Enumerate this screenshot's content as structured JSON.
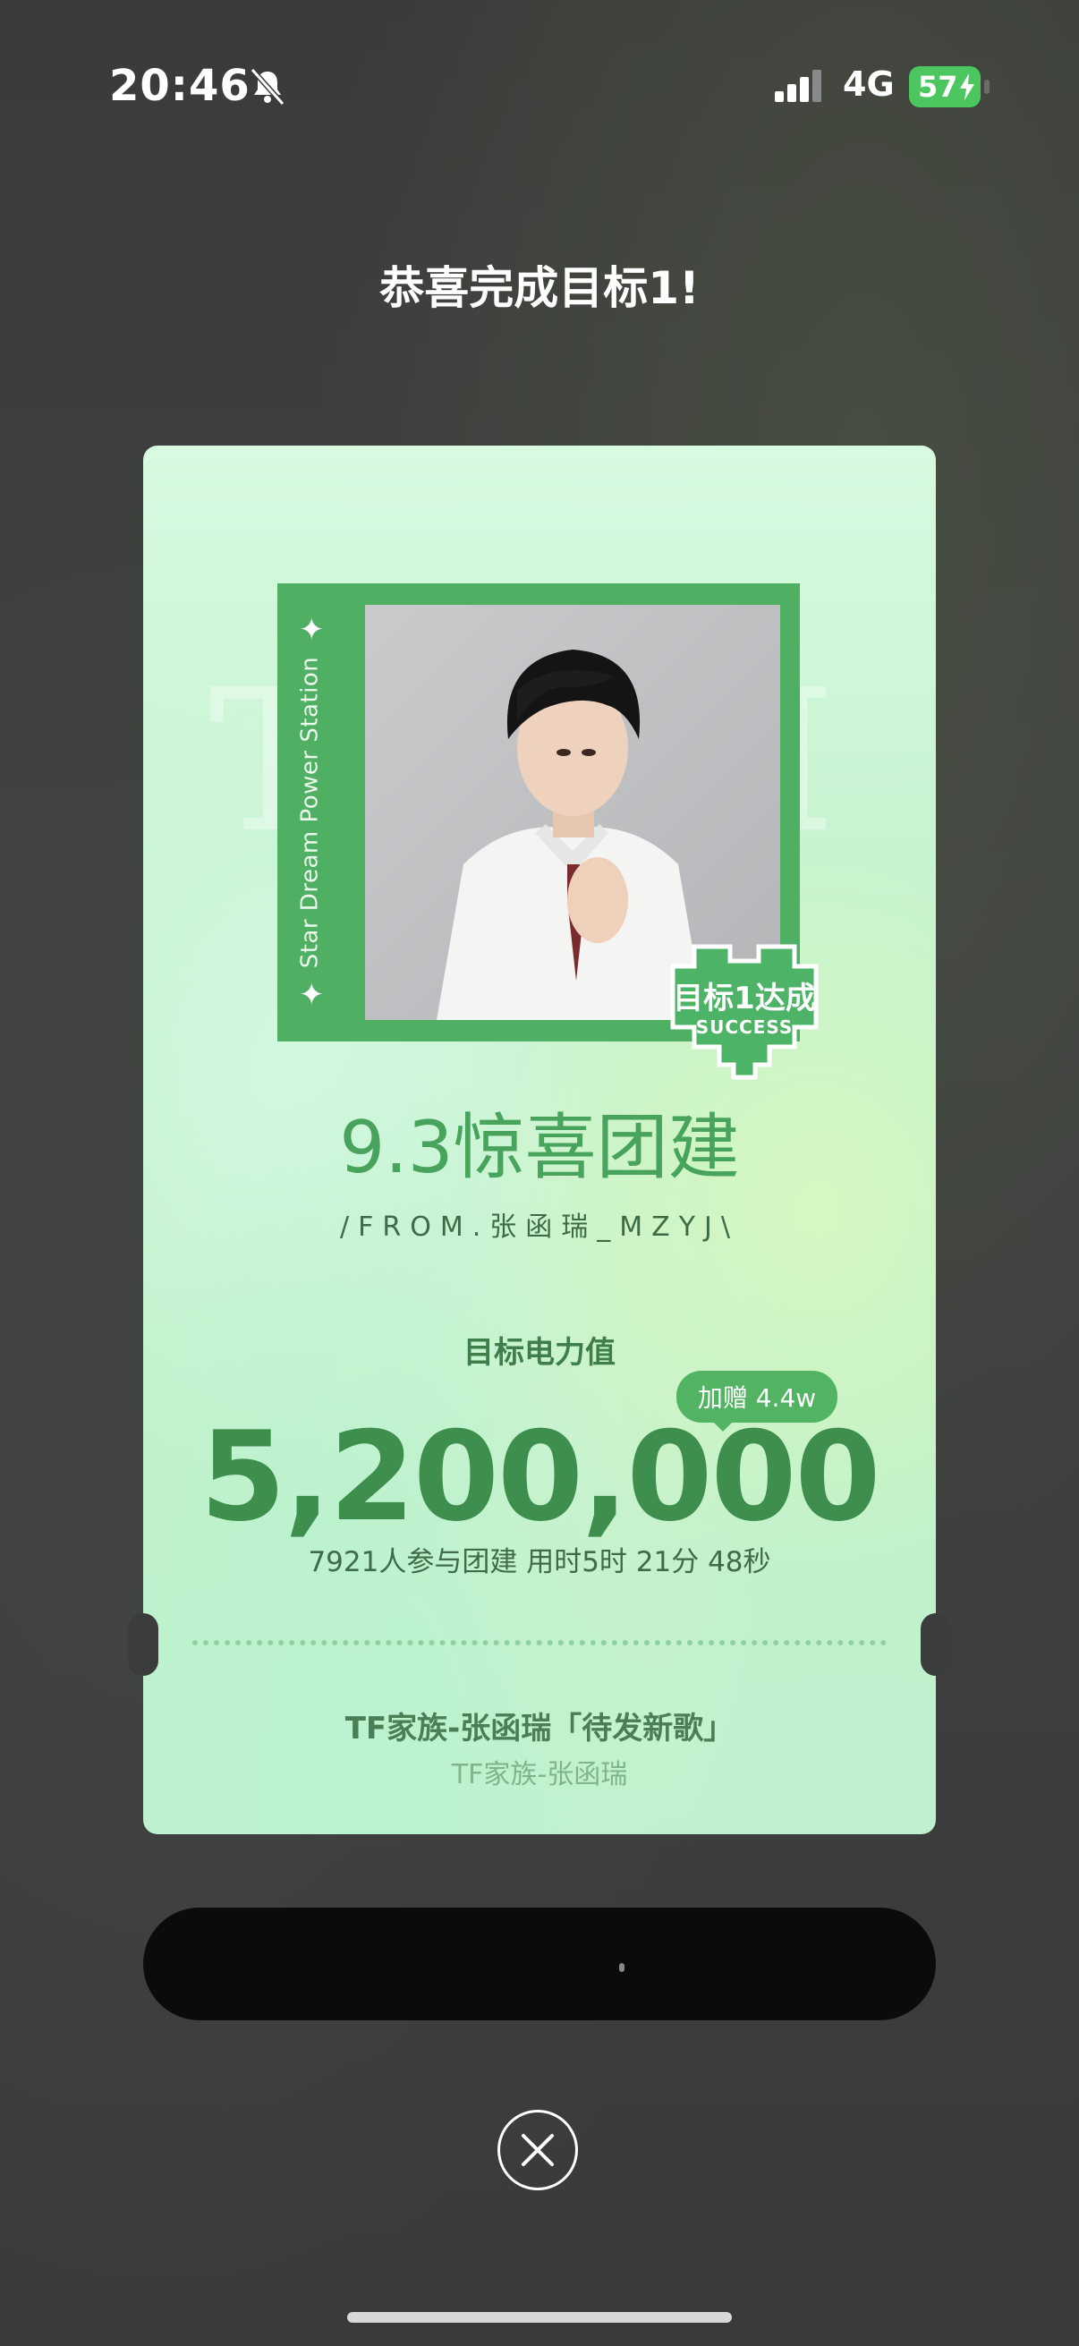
{
  "status_bar": {
    "time": "20:46",
    "network": "4G",
    "battery": "57"
  },
  "dialog": {
    "title": "恭喜完成目标1!"
  },
  "card": {
    "side_text": "Star Dream Power Station",
    "badge_label": "目标1达成",
    "badge_sub": "SUCCESS",
    "event_title": "9.3惊喜团建",
    "from": "/FROM.张函瑞_MZYJ\\",
    "target_label": "目标电力值",
    "bonus": "加赠 4.4w",
    "target_value": "5,200,000",
    "stats": "7921人参与团建 用时5时 21分 48秒",
    "song": "TF家族-张函瑞「待发新歌」",
    "artist": "TF家族-张函瑞"
  },
  "colors": {
    "accent_green": "#4faf63",
    "number_green": "#3e8e4d",
    "battery_green": "#4cc760"
  }
}
